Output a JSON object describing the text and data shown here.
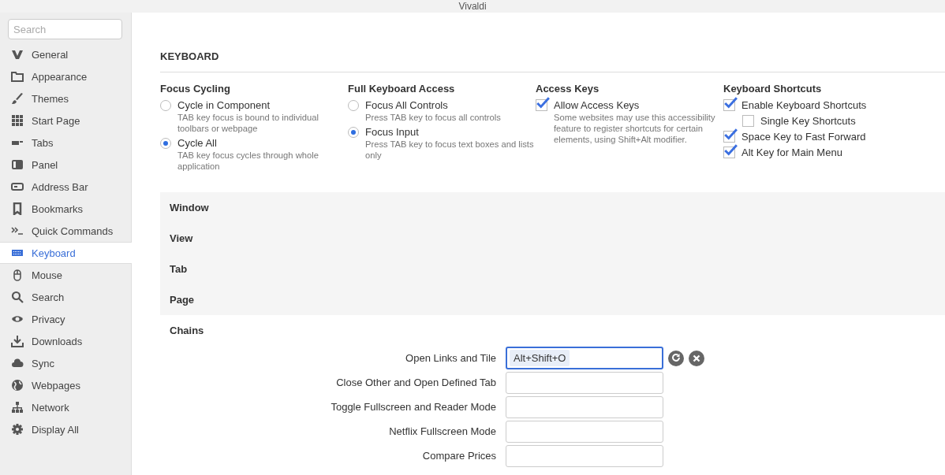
{
  "window": {
    "title": "Vivaldi"
  },
  "sidebar": {
    "search": {
      "placeholder": "Search"
    },
    "items": [
      {
        "label": "General",
        "selected": false
      },
      {
        "label": "Appearance",
        "selected": false
      },
      {
        "label": "Themes",
        "selected": false
      },
      {
        "label": "Start Page",
        "selected": false
      },
      {
        "label": "Tabs",
        "selected": false
      },
      {
        "label": "Panel",
        "selected": false
      },
      {
        "label": "Address Bar",
        "selected": false
      },
      {
        "label": "Bookmarks",
        "selected": false
      },
      {
        "label": "Quick Commands",
        "selected": false
      },
      {
        "label": "Keyboard",
        "selected": true
      },
      {
        "label": "Mouse",
        "selected": false
      },
      {
        "label": "Search",
        "selected": false
      },
      {
        "label": "Privacy",
        "selected": false
      },
      {
        "label": "Downloads",
        "selected": false
      },
      {
        "label": "Sync",
        "selected": false
      },
      {
        "label": "Webpages",
        "selected": false
      },
      {
        "label": "Network",
        "selected": false
      },
      {
        "label": "Display All",
        "selected": false
      }
    ]
  },
  "section": {
    "title": "KEYBOARD"
  },
  "option_groups": [
    {
      "title": "Focus Cycling",
      "kind": "radio",
      "options": [
        {
          "label": "Cycle in Component",
          "description": "TAB key focus is bound to individual toolbars or webpage",
          "selected": false
        },
        {
          "label": "Cycle All",
          "description": "TAB key focus cycles through whole application",
          "selected": true
        }
      ]
    },
    {
      "title": "Full Keyboard Access",
      "kind": "radio",
      "options": [
        {
          "label": "Focus All Controls",
          "description": "Press TAB key to focus all controls",
          "selected": false
        },
        {
          "label": "Focus Input",
          "description": "Press TAB key to focus text boxes and lists only",
          "selected": true
        }
      ]
    },
    {
      "title": "Access Keys",
      "kind": "checkbox",
      "options": [
        {
          "label": "Allow Access Keys",
          "description": "Some websites may use this accessibility feature to register shortcuts for certain elements, using Shift+Alt modifier.",
          "checked": true
        }
      ]
    },
    {
      "title": "Keyboard Shortcuts",
      "kind": "checkbox",
      "options": [
        {
          "label": "Enable Keyboard Shortcuts",
          "checked": true,
          "children": [
            {
              "label": "Single Key Shortcuts",
              "checked": false
            }
          ]
        },
        {
          "label": "Space Key to Fast Forward",
          "checked": true
        },
        {
          "label": "Alt Key for Main Menu",
          "checked": true
        }
      ]
    }
  ],
  "categories": [
    {
      "label": "Window"
    },
    {
      "label": "View"
    },
    {
      "label": "Tab"
    },
    {
      "label": "Page"
    },
    {
      "label": "Chains",
      "commands": [
        {
          "label": "Open Links and Tile",
          "keys": "Alt+Shift+O",
          "focused": true
        },
        {
          "label": "Close Other and Open Defined Tab",
          "focused": false
        },
        {
          "label": "Toggle Fullscreen and Reader Mode",
          "focused": false
        },
        {
          "label": "Netflix Fullscreen Mode",
          "focused": false
        },
        {
          "label": "Compare Prices",
          "focused": false
        }
      ]
    }
  ]
}
